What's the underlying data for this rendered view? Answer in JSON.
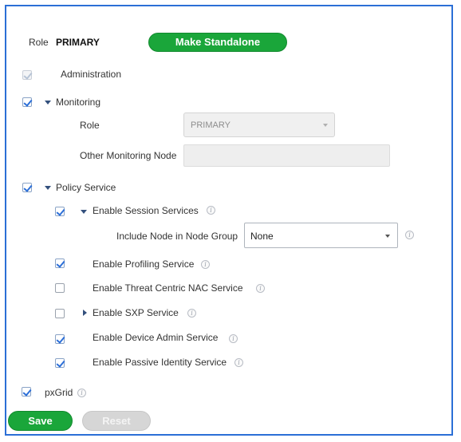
{
  "node": {
    "role_label": "Role",
    "role_value": "PRIMARY",
    "make_standalone_label": "Make Standalone"
  },
  "administration": {
    "label": "Administration",
    "checked": true
  },
  "monitoring": {
    "label": "Monitoring",
    "checked": true,
    "role_label": "Role",
    "role_value": "PRIMARY",
    "other_node_label": "Other Monitoring Node",
    "other_node_value": ""
  },
  "policy_service": {
    "label": "Policy Service",
    "checked": true,
    "session_services": {
      "label": "Enable Session Services",
      "checked": true,
      "node_group_label": "Include Node in Node Group",
      "node_group_value": "None"
    },
    "profiling": {
      "label": "Enable Profiling Service",
      "checked": true
    },
    "threat_centric": {
      "label": "Enable Threat Centric NAC Service",
      "checked": false
    },
    "sxp": {
      "label": "Enable SXP Service",
      "checked": false
    },
    "device_admin": {
      "label": "Enable Device Admin Service",
      "checked": true
    },
    "passive_identity": {
      "label": "Enable Passive Identity Service",
      "checked": true
    }
  },
  "pxgrid": {
    "label": "pxGrid",
    "checked": true
  },
  "actions": {
    "save_label": "Save",
    "reset_label": "Reset"
  },
  "colors": {
    "accent_green": "#1aa63a",
    "border_blue": "#2b6fd6",
    "check_blue": "#2c6fd8"
  },
  "icons": {
    "info": "info-icon",
    "expand": "chevron-down-icon",
    "collapse": "chevron-right-icon"
  }
}
